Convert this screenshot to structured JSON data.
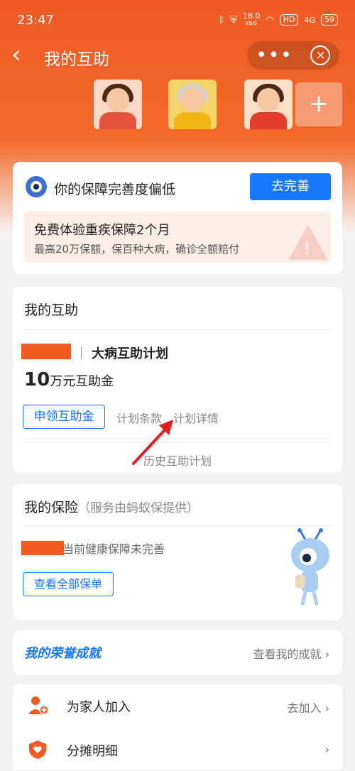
{
  "status_bar": {
    "time": "23:47",
    "speed": "18.0",
    "speed_unit": "KB/S",
    "hd": "HD",
    "network": "4G",
    "battery": "59"
  },
  "nav": {
    "back_icon": "chevron-left-icon",
    "title": "我的互助",
    "more_icon": "more-dots-icon",
    "close_icon": "close-icon"
  },
  "avatars": {
    "add_label": "+"
  },
  "coverage": {
    "message": "你的保障完善度偏低",
    "button": "去完善",
    "promo_title": "免费体验重疾保障2个月",
    "promo_desc": "最高20万保额，保百种大病，确诊全额赔付"
  },
  "mutual_aid": {
    "title": "我的互助",
    "plan_name": "大病互助计划",
    "amount_num": "10",
    "amount_unit": "万元互助金",
    "apply_button": "申领互助金",
    "terms_link": "计划条款",
    "details_link": "计划详情",
    "history_link": "历史互助计划"
  },
  "insurance": {
    "title": "我的保险",
    "subtitle": "（服务由蚂蚁保提供）",
    "health_text": "当前健康保障未完善",
    "view_button": "查看全部保单"
  },
  "honor": {
    "title": "我的荣誉成就",
    "link": "查看我的成就"
  },
  "menu": [
    {
      "label": "为家人加入",
      "right": "去加入",
      "icon": "add-user-icon"
    },
    {
      "label": "分摊明细",
      "right": "",
      "icon": "heart-shield-icon"
    }
  ],
  "colors": {
    "brand_orange": "#f05a24",
    "primary_blue": "#1677ff"
  }
}
